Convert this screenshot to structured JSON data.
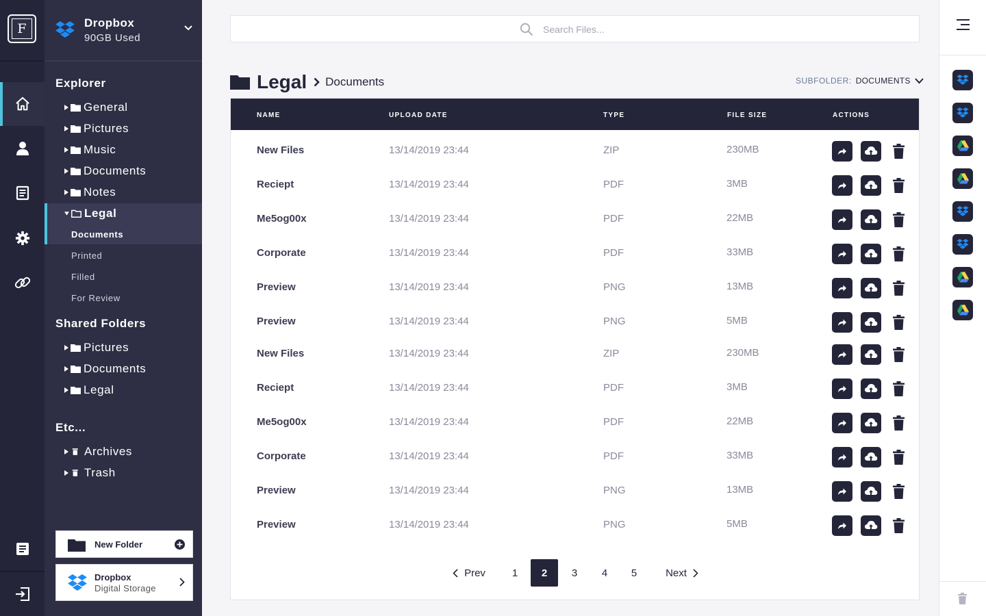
{
  "app": {
    "logo_letter": "F",
    "nav_icons": [
      "home-icon",
      "user-icon",
      "document-icon",
      "settings-icon",
      "link-icon",
      "notes-icon",
      "logout-icon"
    ]
  },
  "account": {
    "service": "Dropbox",
    "usage": "90GB Used"
  },
  "explorer": {
    "title": "Explorer",
    "folders": [
      {
        "label": "General"
      },
      {
        "label": "Pictures"
      },
      {
        "label": "Music"
      },
      {
        "label": "Documents"
      },
      {
        "label": "Notes"
      },
      {
        "label": "Legal",
        "expanded": true
      }
    ],
    "subfolders": [
      {
        "label": "Documents",
        "selected": true
      },
      {
        "label": "Printed"
      },
      {
        "label": "Filled"
      },
      {
        "label": "For Review"
      }
    ]
  },
  "shared": {
    "title": "Shared Folders",
    "folders": [
      {
        "label": "Pictures"
      },
      {
        "label": "Documents"
      },
      {
        "label": "Legal"
      }
    ]
  },
  "etc": {
    "title": "Etc...",
    "items": [
      {
        "label": "Archives"
      },
      {
        "label": "Trash"
      }
    ]
  },
  "actions": {
    "new_folder": "New Folder",
    "storage_title": "Dropbox",
    "storage_subtitle": "Digital Storage"
  },
  "search": {
    "placeholder": "Search Files..."
  },
  "breadcrumb": {
    "folder": "Legal",
    "subfolder": "Documents"
  },
  "subfolder_select": {
    "label": "SUBFOLDER:",
    "value": "DOCUMENTS"
  },
  "table": {
    "columns": [
      "NAME",
      "UPLOAD DATE",
      "TYPE",
      "FILE SIZE",
      "ACTIONS"
    ],
    "rows": [
      {
        "name": "New Files",
        "date": "13/14/2019 23:44",
        "type": "ZIP",
        "size": "230MB"
      },
      {
        "name": "Reciept",
        "date": "13/14/2019 23:44",
        "type": "PDF",
        "size": "3MB"
      },
      {
        "name": "Me5og00x",
        "date": "13/14/2019 23:44",
        "type": "PDF",
        "size": "22MB"
      },
      {
        "name": "Corporate",
        "date": "13/14/2019 23:44",
        "type": "PDF",
        "size": "33MB"
      },
      {
        "name": "Preview",
        "date": "13/14/2019 23:44",
        "type": "PNG",
        "size": "13MB"
      },
      {
        "name": "Preview",
        "date": "13/14/2019 23:44",
        "type": "PNG",
        "size": "5MB"
      },
      {
        "name": "New Files",
        "date": "13/14/2019 23:44",
        "type": "ZIP",
        "size": "230MB"
      },
      {
        "name": "Reciept",
        "date": "13/14/2019 23:44",
        "type": "PDF",
        "size": "3MB"
      },
      {
        "name": "Me5og00x",
        "date": "13/14/2019 23:44",
        "type": "PDF",
        "size": "22MB"
      },
      {
        "name": "Corporate",
        "date": "13/14/2019 23:44",
        "type": "PDF",
        "size": "33MB"
      },
      {
        "name": "Preview",
        "date": "13/14/2019 23:44",
        "type": "PNG",
        "size": "13MB"
      },
      {
        "name": "Preview",
        "date": "13/14/2019 23:44",
        "type": "PNG",
        "size": "5MB"
      }
    ],
    "row_action_icons": [
      "share-icon",
      "cloud-upload-icon",
      "trash-icon"
    ]
  },
  "pagination": {
    "prev": "Prev",
    "next": "Next",
    "pages": [
      "1",
      "2",
      "3",
      "4",
      "5"
    ],
    "current": "2"
  },
  "services": [
    "dropbox",
    "dropbox",
    "google-drive",
    "google-drive",
    "dropbox",
    "dropbox",
    "google-drive",
    "google-drive"
  ],
  "colors": {
    "dark": "#25253a",
    "sidebar": "#2e2e44",
    "accent": "#4fc3dc",
    "dropbox_blue": "#1e8bf5"
  }
}
